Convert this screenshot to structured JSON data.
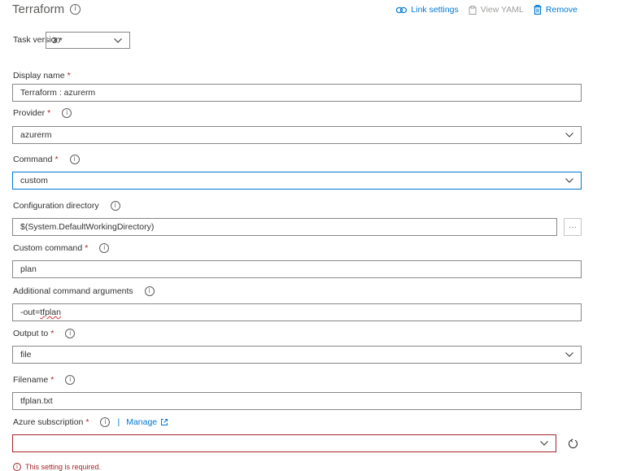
{
  "header": {
    "title": "Terraform",
    "link_settings": "Link settings",
    "view_yaml": "View YAML",
    "remove": "Remove"
  },
  "task_version": {
    "label": "Task version",
    "value": "3.*"
  },
  "fields": {
    "display_name": {
      "label": "Display name",
      "value": "Terraform : azurerm"
    },
    "provider": {
      "label": "Provider",
      "value": "azurerm"
    },
    "command": {
      "label": "Command",
      "value": "custom"
    },
    "config_dir": {
      "label": "Configuration directory",
      "value": "$(System.DefaultWorkingDirectory)",
      "browse": "···"
    },
    "custom_command": {
      "label": "Custom command",
      "value": "plan"
    },
    "additional_args": {
      "label": "Additional command arguments",
      "value_prefix": "-out=",
      "value_word": "tfplan"
    },
    "output_to": {
      "label": "Output to",
      "value": "file"
    },
    "filename": {
      "label": "Filename",
      "value": "tfplan.txt"
    },
    "azure_subscription": {
      "label": "Azure subscription",
      "value": "",
      "manage": "Manage",
      "separator": "|",
      "error": "This setting is required."
    }
  },
  "required_mark": "*",
  "info_glyph": "i",
  "colors": {
    "accent": "#0078d4",
    "error": "#a4262c",
    "border": "#8a8886",
    "text": "#323130"
  }
}
